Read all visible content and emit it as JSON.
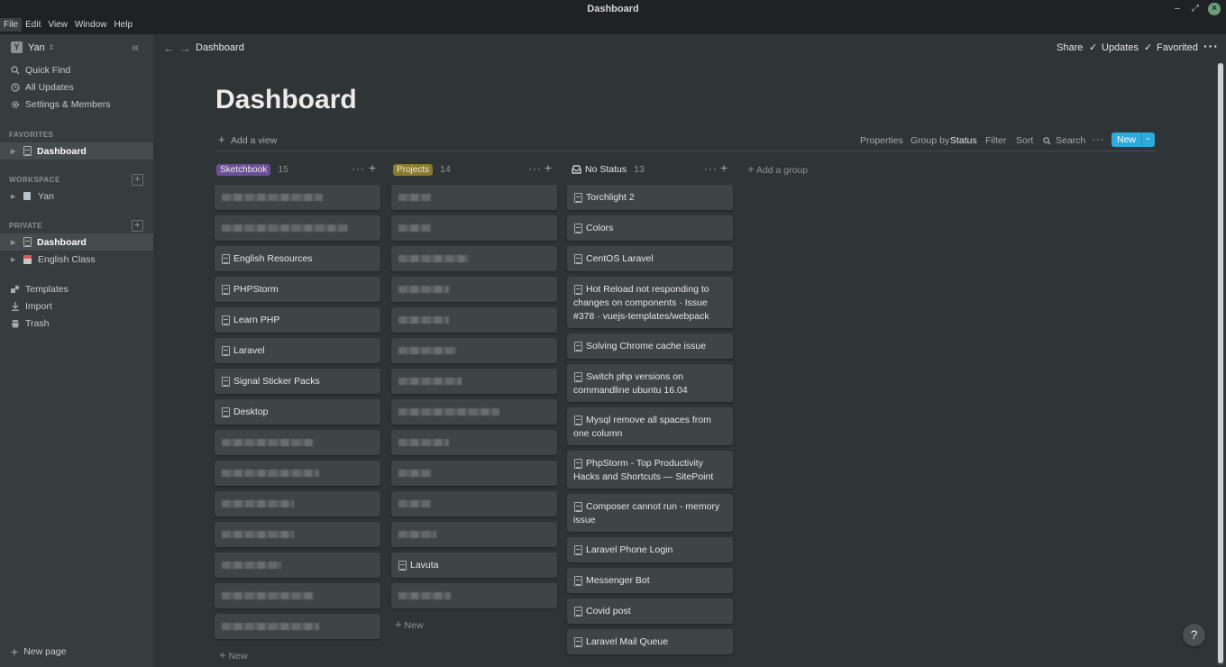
{
  "window": {
    "title": "Dashboard"
  },
  "menu": [
    "File",
    "Edit",
    "View",
    "Window",
    "Help"
  ],
  "sidebar": {
    "workspace_initial": "Y",
    "workspace_name": "Yan",
    "top_items": [
      {
        "label": "Quick Find",
        "icon": "search-icon"
      },
      {
        "label": "All Updates",
        "icon": "clock-icon"
      },
      {
        "label": "Settings & Members",
        "icon": "gear-icon"
      }
    ],
    "favorites_heading": "FAVORITES",
    "favorites": [
      {
        "label": "Dashboard"
      }
    ],
    "workspace_heading": "WORKSPACE",
    "workspace_items": [
      {
        "label": "Yan"
      }
    ],
    "private_heading": "PRIVATE",
    "private_items": [
      {
        "label": "Dashboard"
      },
      {
        "label": "English Class"
      }
    ],
    "bottom_items": [
      {
        "label": "Templates",
        "icon": "templates-icon"
      },
      {
        "label": "Import",
        "icon": "import-icon"
      },
      {
        "label": "Trash",
        "icon": "trash-icon"
      }
    ],
    "new_page": "New page"
  },
  "topbar": {
    "breadcrumb": "Dashboard",
    "share": "Share",
    "updates": "Updates",
    "favorited": "Favorited"
  },
  "page": {
    "title": "Dashboard",
    "add_view": "Add a view",
    "properties": "Properties",
    "group_by_label": "Group by",
    "group_by_value": "Status",
    "filter": "Filter",
    "sort": "Sort",
    "search": "Search",
    "new_button": "New"
  },
  "board": {
    "add_group": "Add a group",
    "new_label": "New",
    "columns": [
      {
        "name": "Sketchbook",
        "count": "15",
        "tag_color": "#6b4f96",
        "cards": [
          "",
          "",
          "English Resources",
          "PHPStorm",
          "Learn PHP",
          "Laravel",
          "Signal Sticker Packs",
          "Desktop",
          "",
          "",
          "",
          "",
          "",
          "",
          ""
        ]
      },
      {
        "name": "Projects",
        "count": "14",
        "tag_color": "#8b7a2e",
        "cards": [
          "",
          "",
          "",
          "",
          "",
          "",
          "",
          "",
          "",
          "",
          "",
          "",
          "Lavuta",
          ""
        ]
      },
      {
        "name": "No Status",
        "count": "13",
        "cards": [
          "Torchlight 2",
          "Colors",
          "CentOS Laravel",
          "Hot Reload not responding to changes on components · Issue #378 · vuejs-templates/webpack",
          "Solving Chrome cache issue",
          "Switch php versions on commandline ubuntu 16.04",
          "Mysql remove all spaces from one column",
          "PhpStorm - Top Productivity Hacks and Shortcuts — SitePoint",
          "Composer cannot run - memory issue",
          "Laravel Phone Login",
          "Messenger Bot",
          "Covid post",
          "Laravel Mail Queue"
        ]
      }
    ]
  },
  "help": "?"
}
